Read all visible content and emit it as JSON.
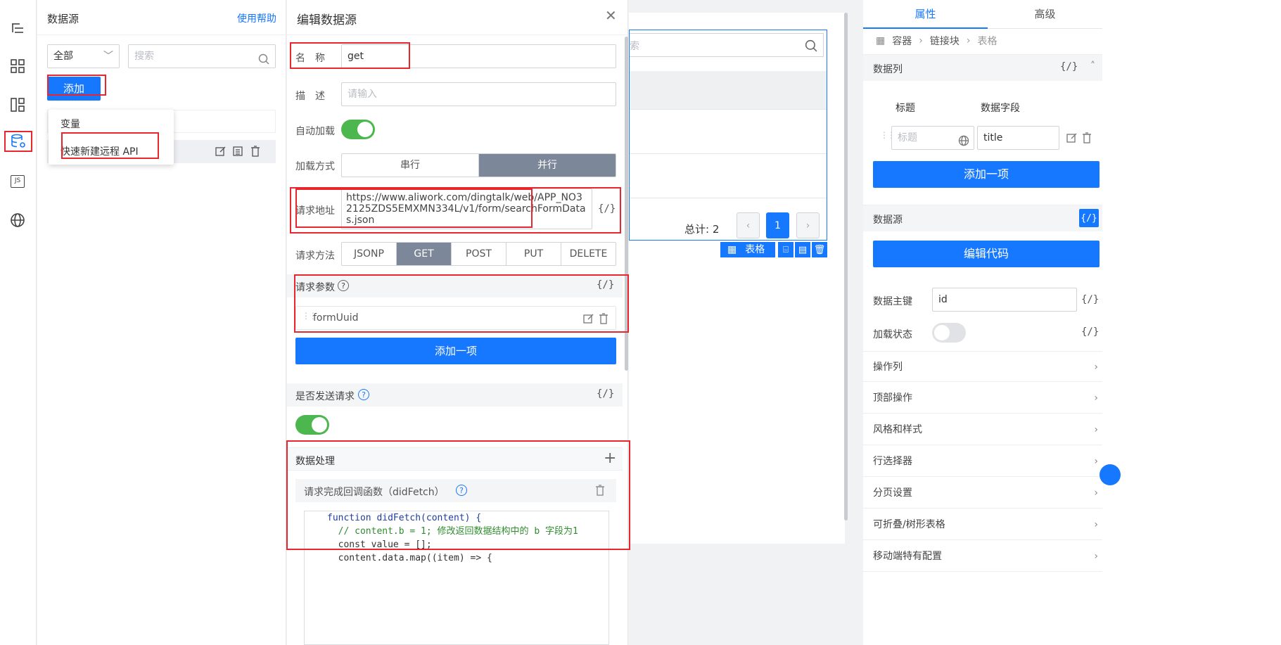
{
  "iconbar": {
    "icons": [
      "outline-icon",
      "components-icon",
      "layout-icon",
      "datasource-icon",
      "js-icon",
      "globe-icon"
    ],
    "js_label": "JS"
  },
  "datasource_panel": {
    "title": "数据源",
    "help_link": "使用帮助",
    "filter_value": "全部",
    "search_placeholder": "搜索",
    "add_button": "添加",
    "dropdown_items": [
      "变量",
      "快速新建远程 API"
    ]
  },
  "editor": {
    "title": "编辑数据源",
    "name_label": "名　称",
    "name_value": "get",
    "desc_label": "描　述",
    "desc_placeholder": "请输入",
    "autoload_label": "自动加载",
    "autoload_on": true,
    "loadmode_label": "加载方式",
    "loadmode_options": [
      "串行",
      "并行"
    ],
    "loadmode_selected": "并行",
    "url_label": "请求地址",
    "url_value": "https://www.aliwork.com/dingtalk/web/APP_NO32125ZDS5EMXMN334L/v1/form/searchFormDatas.json",
    "method_label": "请求方法",
    "method_options": [
      "JSONP",
      "GET",
      "POST",
      "PUT",
      "DELETE"
    ],
    "method_selected": "GET",
    "params_label": "请求参数",
    "params": [
      "formUuid"
    ],
    "add_item_label": "添加一项",
    "send_label": "是否发送请求",
    "send_on": true,
    "processing_label": "数据处理",
    "didfetch_label": "请求完成回调函数（didFetch）",
    "code_lines": [
      "function didFetch(content) {",
      "  // content.b = 1; 修改返回数据结构中的 b 字段为1",
      "  const value = [];",
      "  content.data.map((item) => {"
    ],
    "fx": "{/}"
  },
  "canvas": {
    "search_fragment": "索",
    "total_label": "总计: 2",
    "page_current": "1",
    "component_tag": "表格"
  },
  "right_panel": {
    "tabs": [
      "属性",
      "高级"
    ],
    "active_tab": "属性",
    "breadcrumb": [
      "容器",
      "链接块",
      "表格"
    ],
    "columns_section": "数据列",
    "col_header_title": "标题",
    "col_header_field": "数据字段",
    "col_title_placeholder": "标题",
    "col_field_value": "title",
    "add_item": "添加一项",
    "datasource_section": "数据源",
    "edit_code": "编辑代码",
    "primary_key_label": "数据主键",
    "primary_key_value": "id",
    "loading_label": "加载状态",
    "loading_on": false,
    "sections": [
      "操作列",
      "顶部操作",
      "风格和样式",
      "行选择器",
      "分页设置",
      "可折叠/树形表格",
      "移动端特有配置"
    ]
  },
  "colors": {
    "primary": "#1677ff",
    "toggle_on": "#4cb74f",
    "segment_active": "#7c8799",
    "highlight": "#e8262d"
  }
}
